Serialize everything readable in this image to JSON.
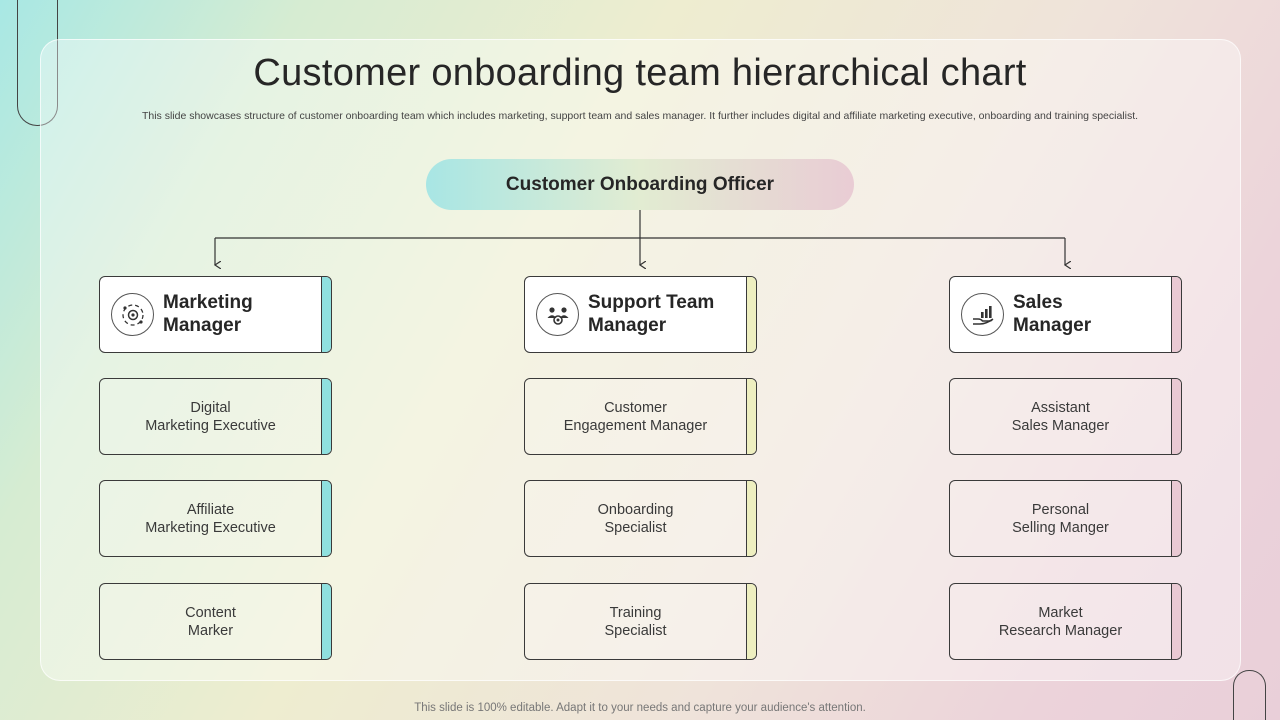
{
  "title": "Customer onboarding team hierarchical chart",
  "subtitle": "This slide showcases structure of customer onboarding team which includes marketing, support team and sales manager. It further includes digital and affiliate marketing executive, onboarding and training specialist.",
  "root": {
    "label": "Customer Onboarding Officer"
  },
  "columns": [
    {
      "head": "Marketing\nManager",
      "icon": "marketing-gear-icon",
      "accent": "#8fe0df",
      "items": [
        "Digital\nMarketing Executive",
        "Affiliate\nMarketing Executive",
        "Content\nMarker"
      ]
    },
    {
      "head": "Support Team\nManager",
      "icon": "team-support-icon",
      "accent": "#eeefc0",
      "items": [
        "Customer\nEngagement Manager",
        "Onboarding\nSpecialist",
        "Training\nSpecialist"
      ]
    },
    {
      "head": "Sales\nManager",
      "icon": "sales-growth-icon",
      "accent": "#e9c9d3",
      "items": [
        "Assistant\nSales Manager",
        "Personal\nSelling Manger",
        "Market\nResearch Manager"
      ]
    }
  ],
  "footer": "This slide is 100% editable. Adapt it to your needs and capture your audience's attention."
}
